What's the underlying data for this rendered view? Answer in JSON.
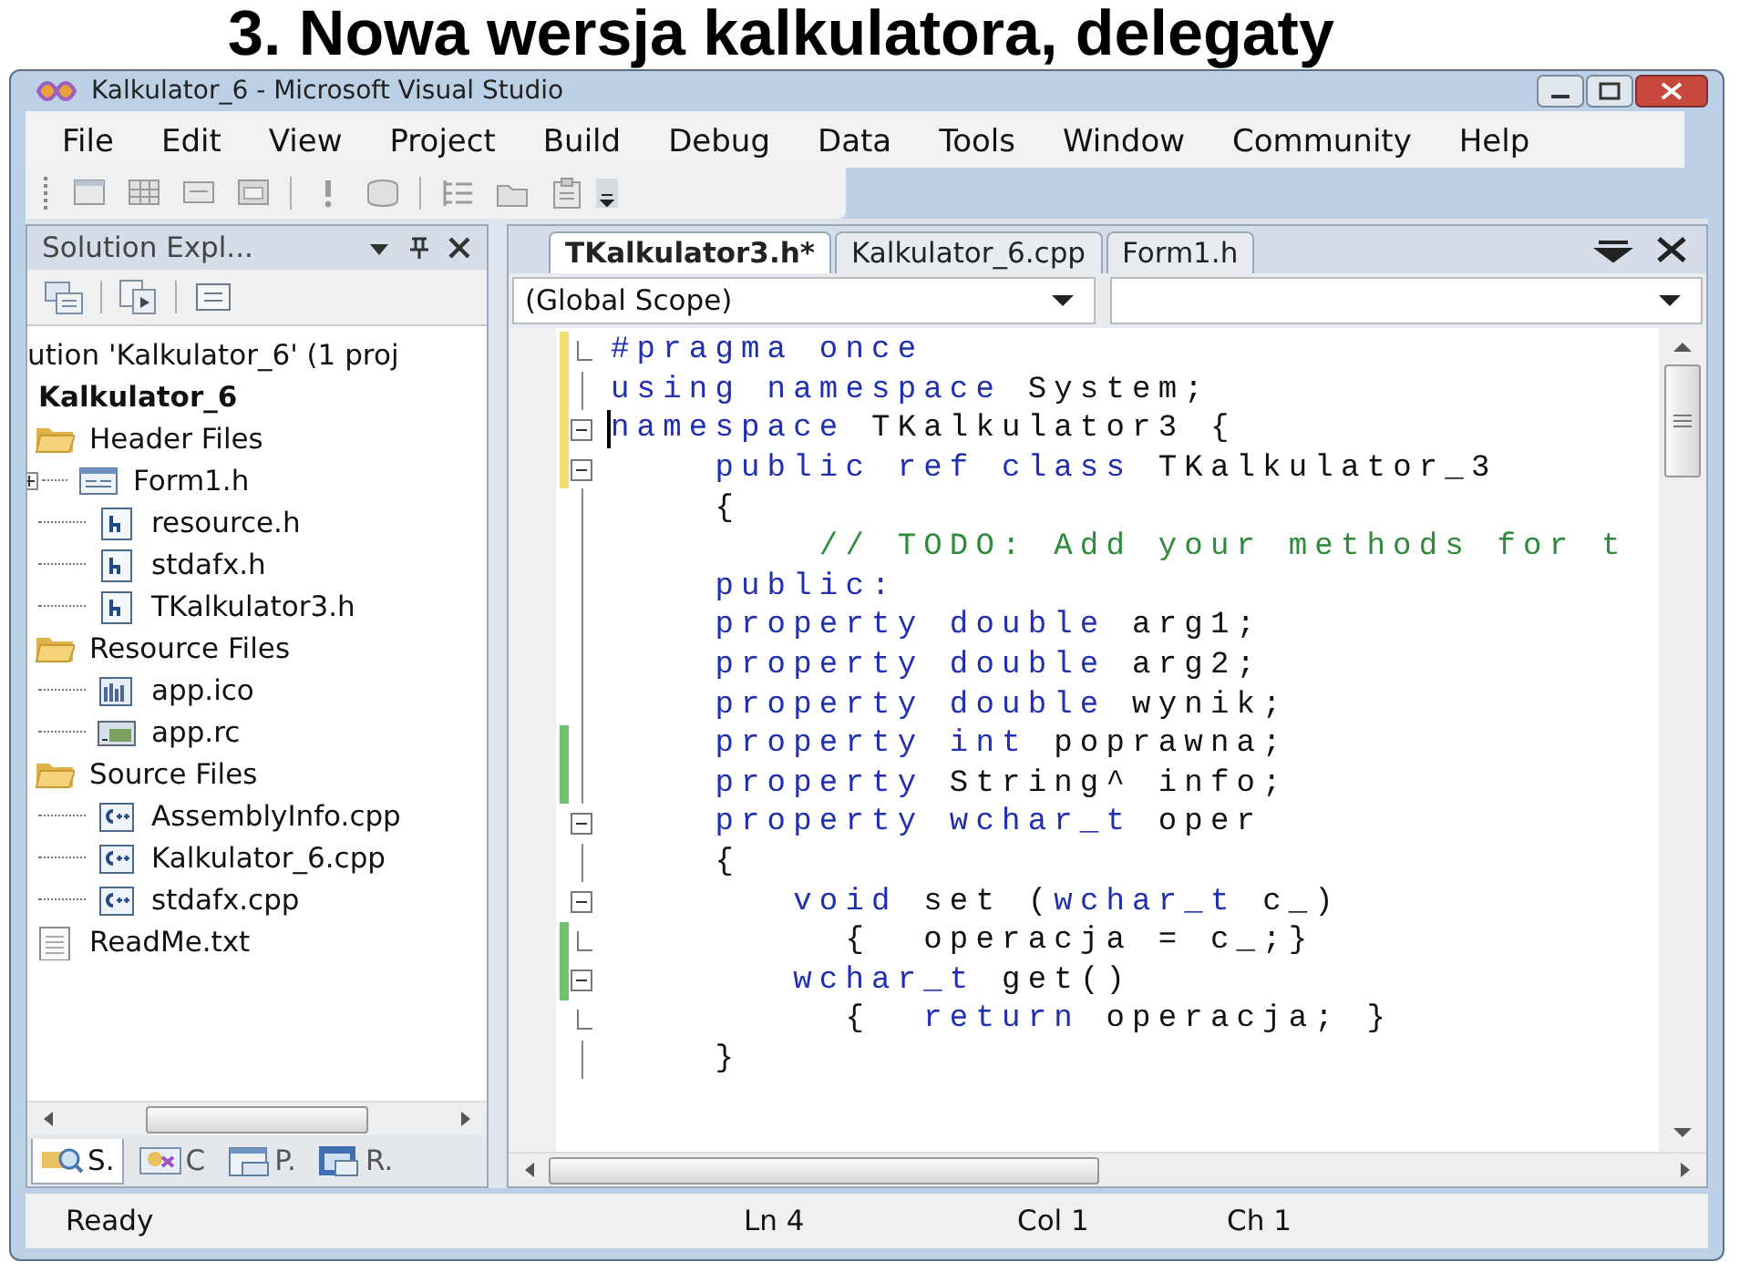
{
  "slide_title": "3. Nowa wersja kalkulatora, delegaty",
  "window": {
    "title": "Kalkulator_6 - Microsoft Visual Studio"
  },
  "menu": [
    "File",
    "Edit",
    "View",
    "Project",
    "Build",
    "Debug",
    "Data",
    "Tools",
    "Window",
    "Community",
    "Help"
  ],
  "solution_explorer": {
    "title": "Solution Expl...",
    "tree": [
      {
        "label": "ution 'Kalkulator_6' (1 proj",
        "kind": "solution",
        "children": [
          {
            "label": "Kalkulator_6",
            "kind": "project",
            "children": [
              {
                "label": "Header Files",
                "kind": "folder",
                "children": [
                  {
                    "label": "Form1.h",
                    "kind": "form",
                    "expanded": false
                  },
                  {
                    "label": "resource.h",
                    "kind": "header"
                  },
                  {
                    "label": "stdafx.h",
                    "kind": "header"
                  },
                  {
                    "label": "TKalkulator3.h",
                    "kind": "header"
                  }
                ]
              },
              {
                "label": "Resource Files",
                "kind": "folder",
                "children": [
                  {
                    "label": "app.ico",
                    "kind": "ico"
                  },
                  {
                    "label": "app.rc",
                    "kind": "rc"
                  }
                ]
              },
              {
                "label": "Source Files",
                "kind": "folder",
                "children": [
                  {
                    "label": "AssemblyInfo.cpp",
                    "kind": "cpp"
                  },
                  {
                    "label": "Kalkulator_6.cpp",
                    "kind": "cpp"
                  },
                  {
                    "label": "stdafx.cpp",
                    "kind": "cpp"
                  }
                ]
              },
              {
                "label": "ReadMe.txt",
                "kind": "txt"
              }
            ]
          }
        ]
      }
    ],
    "tabs": [
      {
        "label": "S.",
        "kind": "solution",
        "selected": true
      },
      {
        "label": "C",
        "kind": "class",
        "selected": false
      },
      {
        "label": "P.",
        "kind": "property",
        "selected": false
      },
      {
        "label": "R.",
        "kind": "resource",
        "selected": false
      }
    ]
  },
  "editor": {
    "tabs": [
      {
        "label": "TKalkulator3.h*",
        "selected": true
      },
      {
        "label": "Kalkulator_6.cpp",
        "selected": false
      },
      {
        "label": "Form1.h",
        "selected": false
      }
    ],
    "scope": "(Global Scope)",
    "lines": [
      {
        "fold_start": false,
        "fold_end": true,
        "changed": true,
        "saved": false,
        "cursor": false,
        "segments": [
          {
            "kind": "keyword",
            "text": "#pragma once"
          }
        ]
      },
      {
        "fold_start": false,
        "fold_end": false,
        "changed": true,
        "saved": false,
        "cursor": false,
        "segments": [
          {
            "kind": "keyword",
            "text": "using namespace"
          },
          {
            "kind": "text",
            "text": " System;"
          }
        ]
      },
      {
        "fold_start": true,
        "fold_end": false,
        "changed": true,
        "saved": false,
        "cursor": true,
        "segments": [
          {
            "kind": "keyword",
            "text": "namespace"
          },
          {
            "kind": "text",
            "text": " TKalkulator3 {"
          }
        ]
      },
      {
        "fold_start": true,
        "fold_end": false,
        "changed": true,
        "saved": false,
        "cursor": false,
        "segments": [
          {
            "kind": "keyword",
            "text": "    public ref class"
          },
          {
            "kind": "text",
            "text": " TKalkulator_3"
          }
        ]
      },
      {
        "fold_start": false,
        "fold_end": false,
        "changed": false,
        "cursor": false,
        "segments": [
          {
            "kind": "text",
            "text": "    {"
          }
        ]
      },
      {
        "fold_start": false,
        "fold_end": false,
        "changed": false,
        "cursor": false,
        "segments": [
          {
            "kind": "comment",
            "text": "        // TODO: Add your methods for t"
          }
        ]
      },
      {
        "fold_start": false,
        "fold_end": false,
        "changed": false,
        "cursor": false,
        "segments": [
          {
            "kind": "keyword",
            "text": "    public:"
          }
        ]
      },
      {
        "fold_start": false,
        "fold_end": false,
        "changed": false,
        "cursor": false,
        "segments": [
          {
            "kind": "keyword",
            "text": "    property double"
          },
          {
            "kind": "text",
            "text": " arg1;"
          }
        ]
      },
      {
        "fold_start": false,
        "fold_end": false,
        "changed": false,
        "cursor": false,
        "segments": [
          {
            "kind": "keyword",
            "text": "    property double"
          },
          {
            "kind": "text",
            "text": " arg2;"
          }
        ]
      },
      {
        "fold_start": false,
        "fold_end": false,
        "changed": false,
        "cursor": false,
        "segments": [
          {
            "kind": "keyword",
            "text": "    property double"
          },
          {
            "kind": "text",
            "text": " wynik;"
          }
        ]
      },
      {
        "fold_start": false,
        "fold_end": false,
        "changed": true,
        "saved": true,
        "cursor": false,
        "segments": [
          {
            "kind": "keyword",
            "text": "    property int"
          },
          {
            "kind": "text",
            "text": " poprawna;"
          }
        ]
      },
      {
        "fold_start": false,
        "fold_end": false,
        "changed": true,
        "saved": true,
        "cursor": false,
        "segments": [
          {
            "kind": "keyword",
            "text": "    property"
          },
          {
            "kind": "text",
            "text": " String^ info;"
          }
        ]
      },
      {
        "fold_start": true,
        "fold_end": false,
        "changed": false,
        "cursor": false,
        "segments": [
          {
            "kind": "keyword",
            "text": "    property wchar_t"
          },
          {
            "kind": "text",
            "text": " oper"
          }
        ]
      },
      {
        "fold_start": false,
        "fold_end": false,
        "changed": false,
        "cursor": false,
        "segments": [
          {
            "kind": "text",
            "text": "    {"
          }
        ]
      },
      {
        "fold_start": true,
        "fold_end": false,
        "changed": false,
        "cursor": false,
        "segments": [
          {
            "kind": "keyword",
            "text": "       void"
          },
          {
            "kind": "text",
            "text": " set ("
          },
          {
            "kind": "keyword",
            "text": "wchar_t"
          },
          {
            "kind": "text",
            "text": " c_)"
          }
        ]
      },
      {
        "fold_start": false,
        "fold_end": true,
        "changed": true,
        "saved": true,
        "cursor": false,
        "segments": [
          {
            "kind": "text",
            "text": "         {  operacja = c_;}"
          }
        ]
      },
      {
        "fold_start": true,
        "fold_end": false,
        "changed": true,
        "saved": true,
        "cursor": false,
        "segments": [
          {
            "kind": "keyword",
            "text": "       wchar_t"
          },
          {
            "kind": "text",
            "text": " get()"
          }
        ]
      },
      {
        "fold_start": false,
        "fold_end": true,
        "changed": false,
        "cursor": false,
        "segments": [
          {
            "kind": "text",
            "text": "         {  "
          },
          {
            "kind": "keyword",
            "text": "return"
          },
          {
            "kind": "text",
            "text": " operacja; }"
          }
        ]
      },
      {
        "fold_start": false,
        "fold_end": false,
        "changed": false,
        "cursor": false,
        "segments": [
          {
            "kind": "text",
            "text": "    }"
          }
        ]
      }
    ]
  },
  "status_bar": {
    "message": "Ready",
    "line": "Ln 4",
    "column": "Col 1",
    "char": "Ch 1"
  }
}
